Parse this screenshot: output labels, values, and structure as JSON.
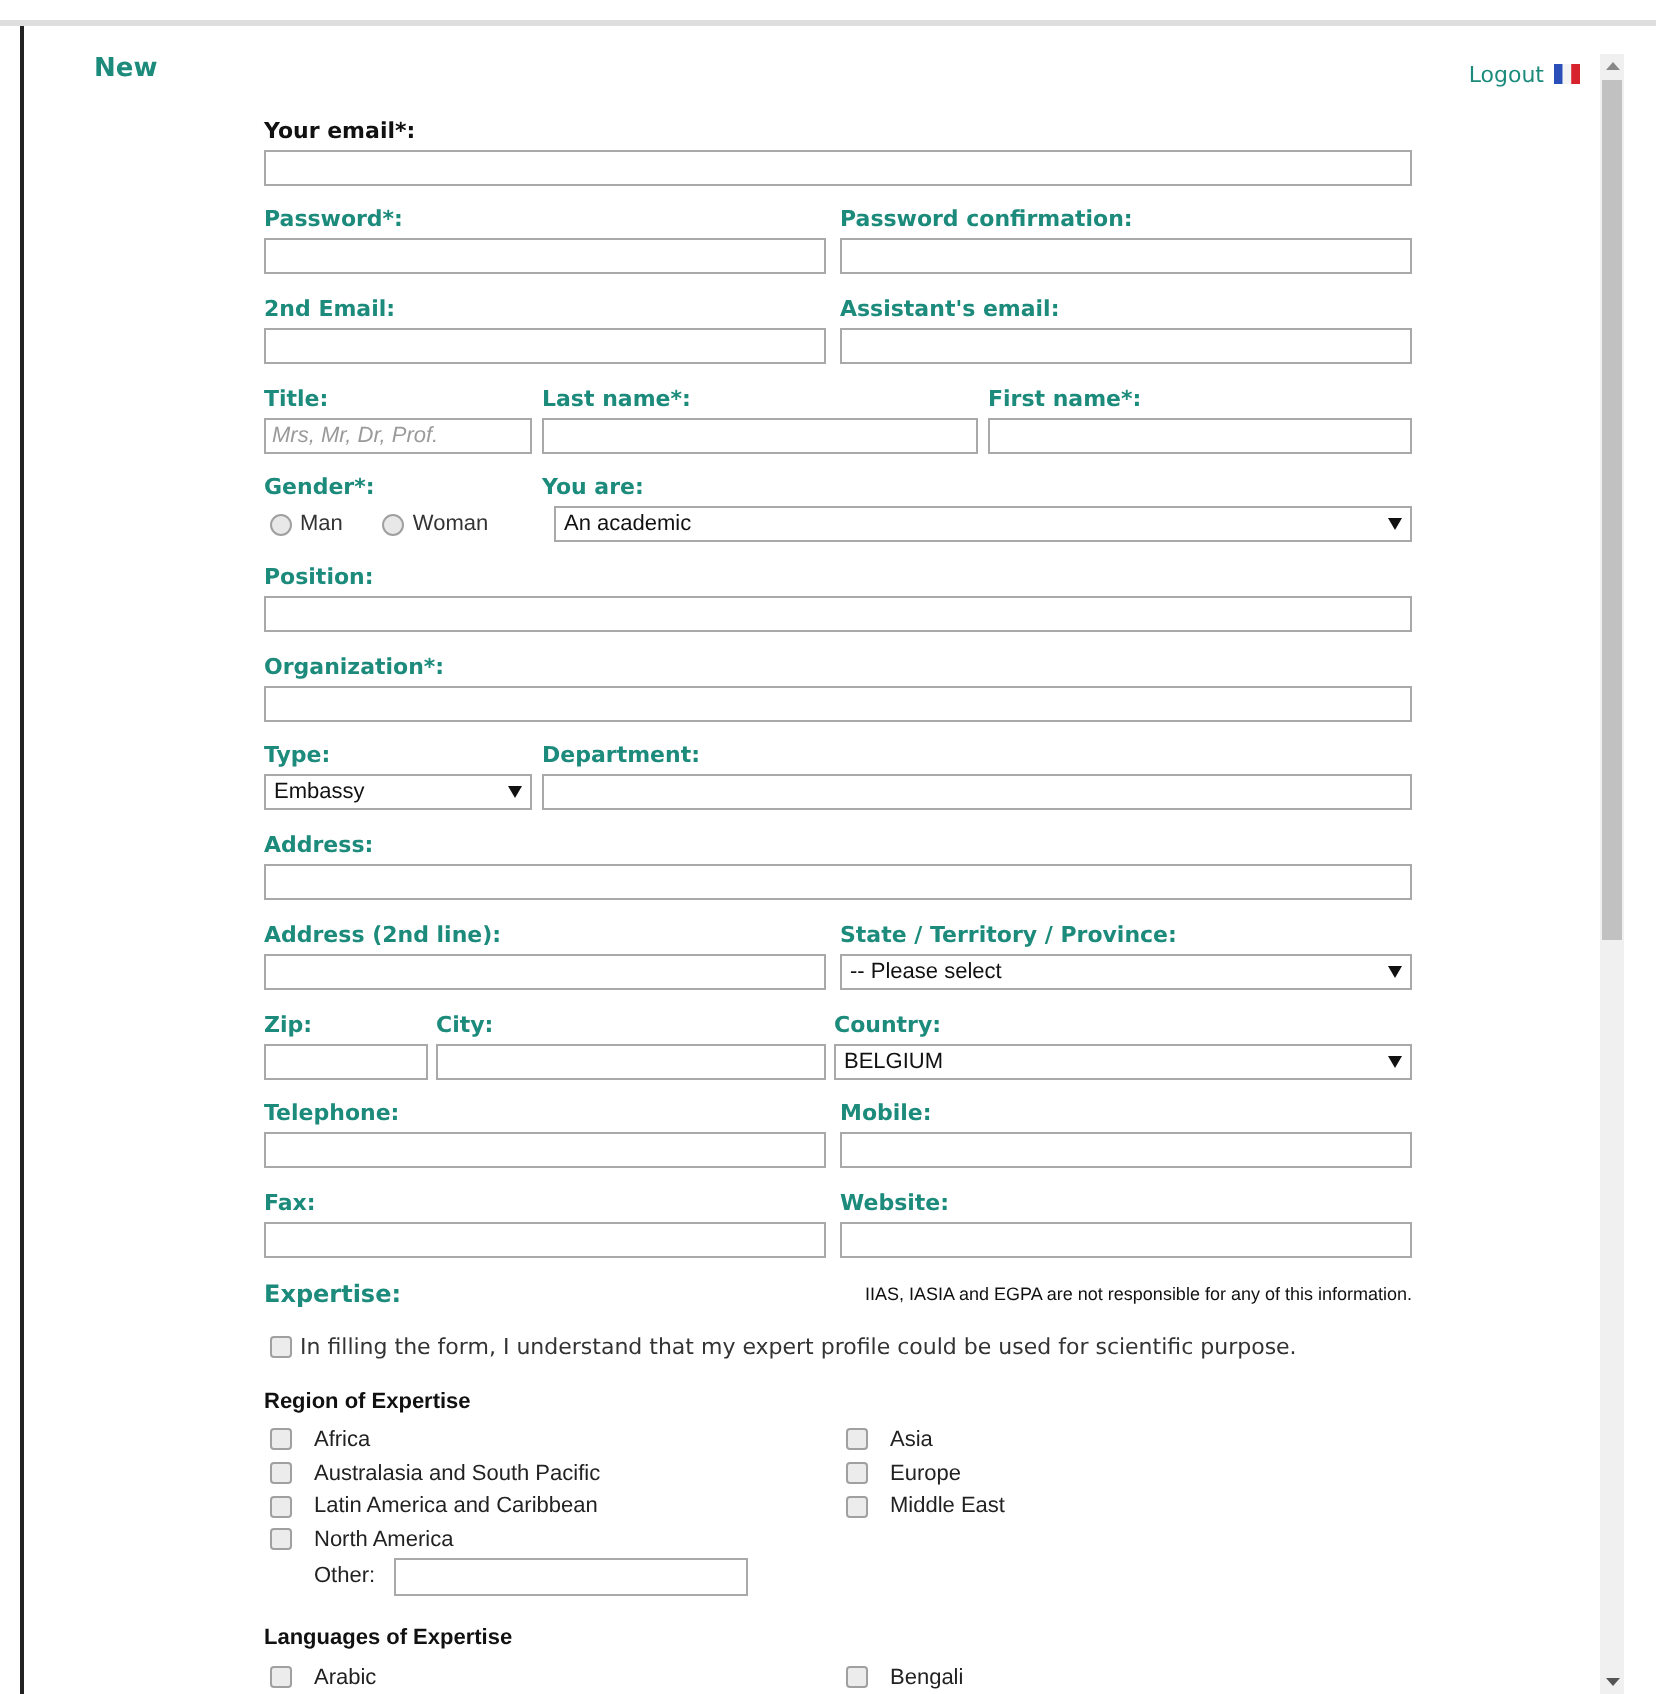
{
  "header": {
    "title": "New",
    "logout": "Logout"
  },
  "rows": [
    {
      "kind": "full",
      "fields": [
        {
          "label": "Your email*:",
          "kind": "input",
          "color": "#111111"
        }
      ]
    },
    {
      "kind": "halves",
      "fields": [
        {
          "label": "Password*:",
          "kind": "input"
        },
        {
          "label": "Password confirmation:",
          "kind": "input"
        }
      ]
    },
    {
      "kind": "halves",
      "fields": [
        {
          "label": "2nd Email:",
          "kind": "input"
        },
        {
          "label": "Assistant's email:",
          "kind": "input"
        }
      ]
    },
    {
      "kind": "thirds",
      "fields": [
        {
          "label": "Title:",
          "kind": "input",
          "placeholder": "Mrs, Mr, Dr, Prof."
        },
        {
          "label": "Last name*:",
          "kind": "input"
        },
        {
          "label": "First name*:",
          "kind": "input"
        }
      ]
    },
    {
      "kind": "narrow-wide",
      "fields": [
        {
          "label": "Gender*:",
          "kind": "radios",
          "options": [
            {
              "label": "Man",
              "selected": false
            },
            {
              "label": "Woman",
              "selected": false
            }
          ]
        },
        {
          "label": "You are:",
          "kind": "select",
          "value": "An academic"
        }
      ]
    },
    {
      "kind": "full",
      "fields": [
        {
          "label": "Position:",
          "kind": "input"
        }
      ]
    },
    {
      "kind": "full",
      "fields": [
        {
          "label": "Organization*:",
          "kind": "input"
        }
      ]
    },
    {
      "kind": "narrow-wide",
      "fields": [
        {
          "label": "Type:",
          "kind": "select",
          "value": "Embassy"
        },
        {
          "label": "Department:",
          "kind": "input"
        }
      ]
    },
    {
      "kind": "full",
      "fields": [
        {
          "label": "Address:",
          "kind": "input"
        }
      ]
    },
    {
      "kind": "halves",
      "fields": [
        {
          "label": "Address (2nd line):",
          "kind": "input"
        },
        {
          "label": "State / Territory / Province:",
          "kind": "select",
          "value": "-- Please select"
        }
      ]
    },
    {
      "kind": "split",
      "fields": [
        {
          "label": "Zip:",
          "kind": "input"
        },
        {
          "label": "City:",
          "kind": "input"
        },
        {
          "label": "Country:",
          "kind": "select",
          "value": "BELGIUM"
        }
      ]
    },
    {
      "kind": "halves",
      "fields": [
        {
          "label": "Telephone:",
          "kind": "input"
        },
        {
          "label": "Mobile:",
          "kind": "input"
        }
      ]
    },
    {
      "kind": "halves",
      "fields": [
        {
          "label": "Fax:",
          "kind": "input"
        },
        {
          "label": "Website:",
          "kind": "input"
        }
      ]
    }
  ],
  "expertise": {
    "title": "Expertise:",
    "note": "IIAS, IASIA and EGPA are not responsible for any of this information.",
    "consent": {
      "label": "In filling the form, I understand that my expert profile could be used for scientific purpose.",
      "checked": false
    }
  },
  "groups": [
    {
      "title": "Region of Expertise",
      "items": [
        {
          "label": "Africa",
          "checked": false
        },
        {
          "label": "Asia",
          "checked": false
        },
        {
          "label": "Australasia and South Pacific",
          "checked": false
        },
        {
          "label": "Europe",
          "checked": false
        },
        {
          "label": "Latin America and Caribbean",
          "checked": false
        },
        {
          "label": "Middle East",
          "checked": false
        },
        {
          "label": "North America",
          "checked": false
        }
      ],
      "other": {
        "label": "Other:"
      }
    },
    {
      "title": "Languages of Expertise",
      "items": [
        {
          "label": "Arabic",
          "checked": false
        },
        {
          "label": "Bengali",
          "checked": false
        }
      ]
    }
  ]
}
